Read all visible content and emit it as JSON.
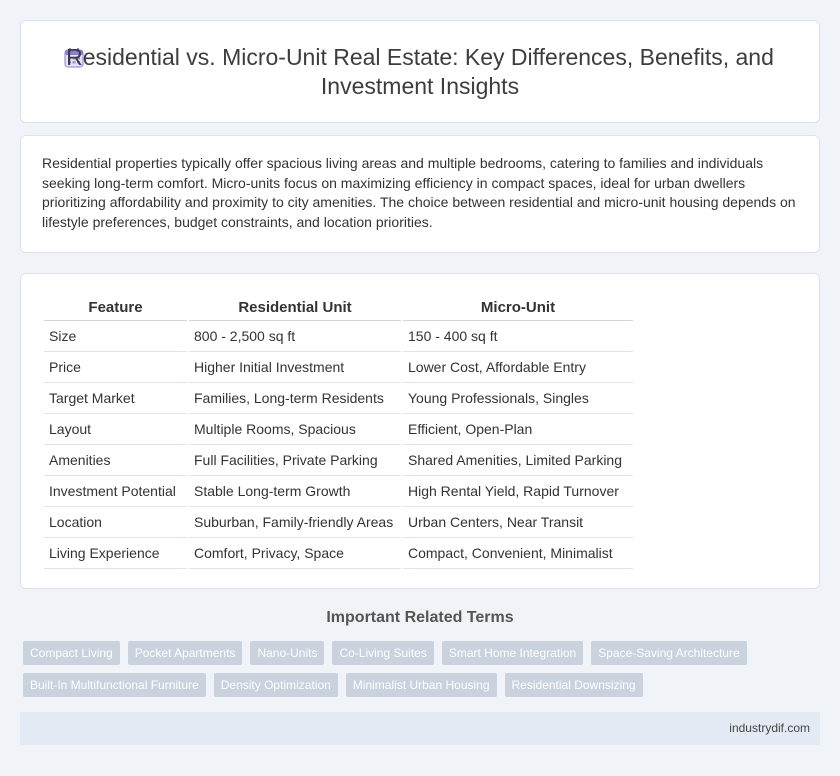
{
  "header": {
    "icon": "calendar-icon",
    "title": "Residential vs. Micro-Unit Real Estate: Key Differences, Benefits, and Investment Insights"
  },
  "intro": {
    "text": "Residential properties typically offer spacious living areas and multiple bedrooms, catering to families and individuals seeking long-term comfort. Micro-units focus on maximizing efficiency in compact spaces, ideal for urban dwellers prioritizing affordability and proximity to city amenities. The choice between residential and micro-unit housing depends on lifestyle preferences, budget constraints, and location priorities."
  },
  "table": {
    "headers": [
      "Feature",
      "Residential Unit",
      "Micro-Unit"
    ],
    "rows": [
      [
        "Size",
        "800 - 2,500 sq ft",
        "150 - 400 sq ft"
      ],
      [
        "Price",
        "Higher Initial Investment",
        "Lower Cost, Affordable Entry"
      ],
      [
        "Target Market",
        "Families, Long-term Residents",
        "Young Professionals, Singles"
      ],
      [
        "Layout",
        "Multiple Rooms, Spacious",
        "Efficient, Open-Plan"
      ],
      [
        "Amenities",
        "Full Facilities, Private Parking",
        "Shared Amenities, Limited Parking"
      ],
      [
        "Investment Potential",
        "Stable Long-term Growth",
        "High Rental Yield, Rapid Turnover"
      ],
      [
        "Location",
        "Suburban, Family-friendly Areas",
        "Urban Centers, Near Transit"
      ],
      [
        "Living Experience",
        "Comfort, Privacy, Space",
        "Compact, Convenient, Minimalist"
      ]
    ]
  },
  "related": {
    "title": "Important Related Terms",
    "tags": [
      "Compact Living",
      "Pocket Apartments",
      "Nano-Units",
      "Co-Living Suites",
      "Smart Home Integration",
      "Space-Saving Architecture",
      "Built-In Multifunctional Furniture",
      "Density Optimization",
      "Minimalist Urban Housing",
      "Residential Downsizing"
    ]
  },
  "footer": {
    "site": "industrydif.com"
  },
  "colors": {
    "background": "#f0f3f8",
    "tag_bg": "#c9d2dd",
    "footer_bg": "#e4eaf3",
    "icon_accent": "#8a7fd6"
  }
}
